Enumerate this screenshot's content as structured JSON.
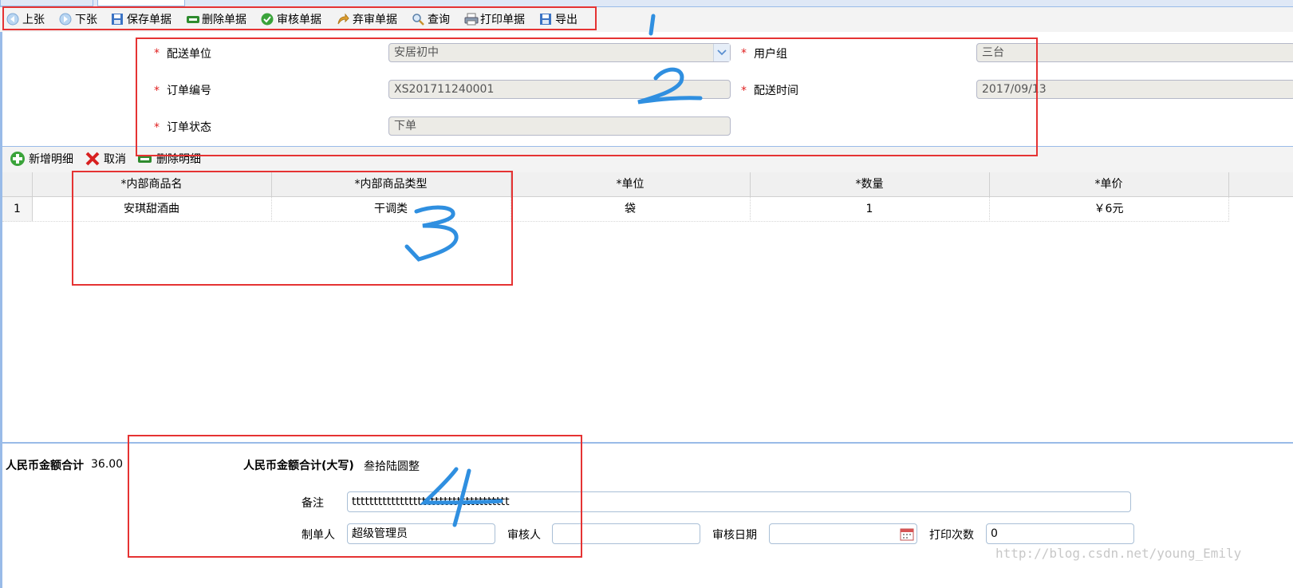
{
  "toolbar": {
    "items": [
      {
        "label": "上张",
        "icon": "arrow-left-icon"
      },
      {
        "label": "下张",
        "icon": "arrow-right-icon"
      },
      {
        "label": "保存单据",
        "icon": "save-icon"
      },
      {
        "label": "删除单据",
        "icon": "delete-icon"
      },
      {
        "label": "审核单据",
        "icon": "check-icon"
      },
      {
        "label": "弃审单据",
        "icon": "undo-icon"
      },
      {
        "label": "查询",
        "icon": "search-icon"
      },
      {
        "label": "打印单据",
        "icon": "print-icon"
      },
      {
        "label": "导出",
        "icon": "export-icon"
      }
    ]
  },
  "form": {
    "required_mark": "*",
    "delivery_unit": {
      "label": "配送单位",
      "value": "安居初中"
    },
    "user_group": {
      "label": "用户组",
      "value": "三台"
    },
    "order_no": {
      "label": "订单编号",
      "value": "XS201711240001"
    },
    "delivery_time": {
      "label": "配送时间",
      "value": "2017/09/13"
    },
    "order_status": {
      "label": "订单状态",
      "value": "下单"
    }
  },
  "detail_toolbar": {
    "add": "新增明细",
    "cancel": "取消",
    "delete": "删除明细"
  },
  "grid": {
    "columns": [
      "*内部商品名",
      "*内部商品类型",
      "*单位",
      "*数量",
      "*单价"
    ],
    "rows": [
      {
        "index": "1",
        "cells": [
          "安琪甜酒曲",
          "干调类",
          "袋",
          "1",
          "￥6元"
        ]
      }
    ]
  },
  "summary": {
    "total_label": "人民币金额合计",
    "total_value": "36.00",
    "total_upper_label": "人民币金额合计(大写)",
    "total_upper_value": "叁拾陆圆整"
  },
  "bottom": {
    "remark_label": "备注",
    "remark_value": "tttttttttttttttttttttttttttttttttttt",
    "creator_label": "制单人",
    "creator_value": "超级管理员",
    "reviewer_label": "审核人",
    "reviewer_value": "",
    "review_date_label": "审核日期",
    "review_date_value": "",
    "print_count_label": "打印次数",
    "print_count_value": "0"
  },
  "annotations": [
    "1",
    "2",
    "3",
    "4"
  ],
  "watermark": "http://blog.csdn.net/young_Emily",
  "colors": {
    "highlight_box": "#e53333",
    "handwriting": "#2f8fe0",
    "required": "#e02020"
  }
}
